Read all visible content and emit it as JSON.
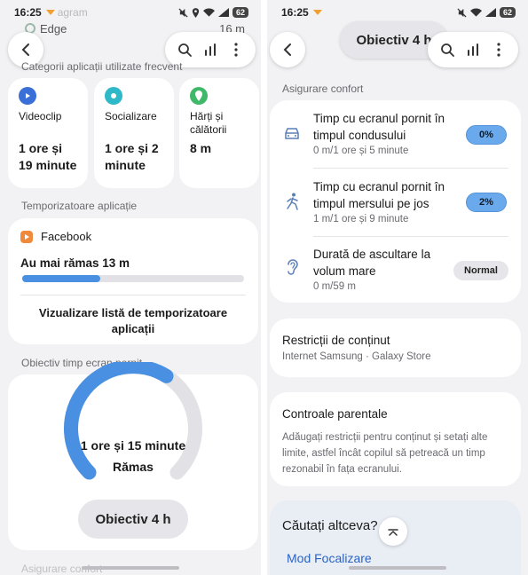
{
  "left": {
    "status": {
      "time": "16:25",
      "app_hint": "agram",
      "battery": "62"
    },
    "peek_row": {
      "name": "Edge",
      "value": "16 m"
    },
    "categories": {
      "title": "Categorii aplicații utilizate frecvent",
      "items": [
        {
          "name": "Videoclip",
          "time": "1 ore și 19 minute",
          "color": "#3b6fd8"
        },
        {
          "name": "Socializare",
          "time": "1 ore și 2 minute",
          "color": "#2fb8c8"
        },
        {
          "name": "Hărți și călătorii",
          "time": "8 m",
          "color": "#3fb86a"
        }
      ]
    },
    "timers": {
      "title": "Temporizatoare aplicație",
      "app": "Facebook",
      "remaining": "Au mai rămas 13 m",
      "progress": 0.35,
      "list_button": "Vizualizare listă de temporizatoare aplicații"
    },
    "goal": {
      "title": "Obiectiv timp ecran pornit",
      "value": "1 ore și 15 minute",
      "sub": "Rămas",
      "progress": 0.62,
      "button": "Obiectiv 4 h"
    },
    "bottom_peek": "Asigurare confort"
  },
  "right": {
    "status": {
      "time": "16:25",
      "battery": "62"
    },
    "floating_goal": "Obiectiv 4 h",
    "comfort": {
      "title": "Asigurare confort",
      "rows": [
        {
          "title": "Timp cu ecranul pornit în timpul condusului",
          "sub": "0 m/1 ore și 5 minute",
          "badge": "0%"
        },
        {
          "title": "Timp cu ecranul pornit în timpul mersului pe jos",
          "sub": "1 m/1 ore și 9 minute",
          "badge": "2%"
        },
        {
          "title": "Durată de ascultare la volum mare",
          "sub": "0 m/59 m",
          "badge": "Normal"
        }
      ]
    },
    "restrictions": {
      "title": "Restricții de conținut",
      "sub": "Internet Samsung · Galaxy Store"
    },
    "parental": {
      "title": "Controale parentale",
      "sub": "Adăugați restricții pentru conținut și setați alte limite, astfel încât copilul să petreacă un timp rezonabil în fața ecranului."
    },
    "search": {
      "title": "Căutați altceva?",
      "link": "Mod Focalizare"
    }
  },
  "colors": {
    "accent": "#4a90e2",
    "track": "#e2e2e6"
  }
}
